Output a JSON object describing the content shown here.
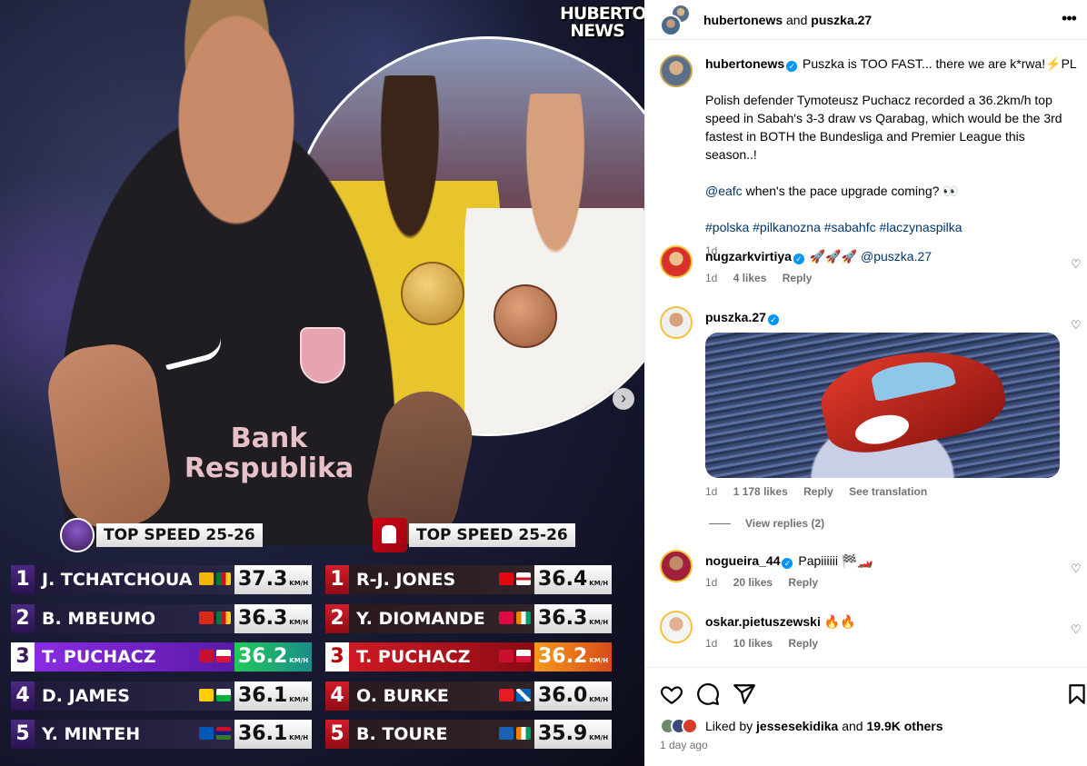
{
  "header": {
    "user1": "hubertonews",
    "joiner": "and",
    "user2": "puszka.27"
  },
  "brand_logo": [
    "HUBERTO",
    "NEWS"
  ],
  "graphic": {
    "sponsor_text": [
      "Bank",
      "Respublika"
    ],
    "pl_title": "TOP SPEED 25-26",
    "bl_title": "TOP SPEED 25-26",
    "unit": "KM/H",
    "pl_rows": [
      {
        "rank": "1",
        "name": "J. TCHATCHOUA",
        "speed": "37.3",
        "highlight": false
      },
      {
        "rank": "2",
        "name": "B. MBEUMO",
        "speed": "36.3",
        "highlight": false
      },
      {
        "rank": "3",
        "name": "T. PUCHACZ",
        "speed": "36.2",
        "highlight": true
      },
      {
        "rank": "4",
        "name": "D. JAMES",
        "speed": "36.1",
        "highlight": false
      },
      {
        "rank": "5",
        "name": "Y. MINTEH",
        "speed": "36.1",
        "highlight": false
      }
    ],
    "bl_rows": [
      {
        "rank": "1",
        "name": "R-J. JONES",
        "speed": "36.4",
        "highlight": false
      },
      {
        "rank": "2",
        "name": "Y. DIOMANDE",
        "speed": "36.3",
        "highlight": false
      },
      {
        "rank": "3",
        "name": "T. PUCHACZ",
        "speed": "36.2",
        "highlight": true
      },
      {
        "rank": "4",
        "name": "O. BURKE",
        "speed": "36.0",
        "highlight": false
      },
      {
        "rank": "5",
        "name": "B. TOURE",
        "speed": "35.9",
        "highlight": false
      }
    ]
  },
  "caption": {
    "username": "hubertonews",
    "headline": "Puszka is TOO FAST... there we are k*rwa!⚡PL",
    "paragraph": "Polish defender Tymoteusz Puchacz recorded a 36.2km/h top speed in Sabah's 3-3 draw vs Qarabag, which would be the 3rd fastest in BOTH the Bundesliga and Premier League this season..!",
    "mention": "@eafc",
    "question": "when's the pace upgrade coming? 👀",
    "hashtags": "#polska #pilkanozna #sabahfc #laczynaspilka",
    "time": "1d"
  },
  "comments": [
    {
      "username": "nugzarkvirtiya",
      "text_pre": "🚀🚀🚀",
      "mention": "@puszka.27",
      "time": "1d",
      "likes": "4 likes",
      "reply": "Reply"
    },
    {
      "username": "puszka.27",
      "time": "1d",
      "likes": "1 178 likes",
      "reply": "Reply",
      "translation": "See translation"
    },
    {
      "username": "nogueira_44",
      "text": "Papiiiiii 🏁🏎️",
      "time": "1d",
      "likes": "20 likes",
      "reply": "Reply"
    },
    {
      "username": "oskar.pietuszewski",
      "text": "🔥🔥",
      "time": "1d",
      "likes": "10 likes",
      "reply": "Reply"
    }
  ],
  "view_replies": "View replies (2)",
  "liked_by": {
    "prefix": "Liked by",
    "user": "jessesekidika",
    "joiner": "and",
    "count": "19.9K others"
  },
  "post_date": "1 day ago",
  "colors": {
    "link": "#00376b",
    "verified": "#0095f6",
    "pl_purple": "#3d195b",
    "bl_red": "#d20515"
  }
}
